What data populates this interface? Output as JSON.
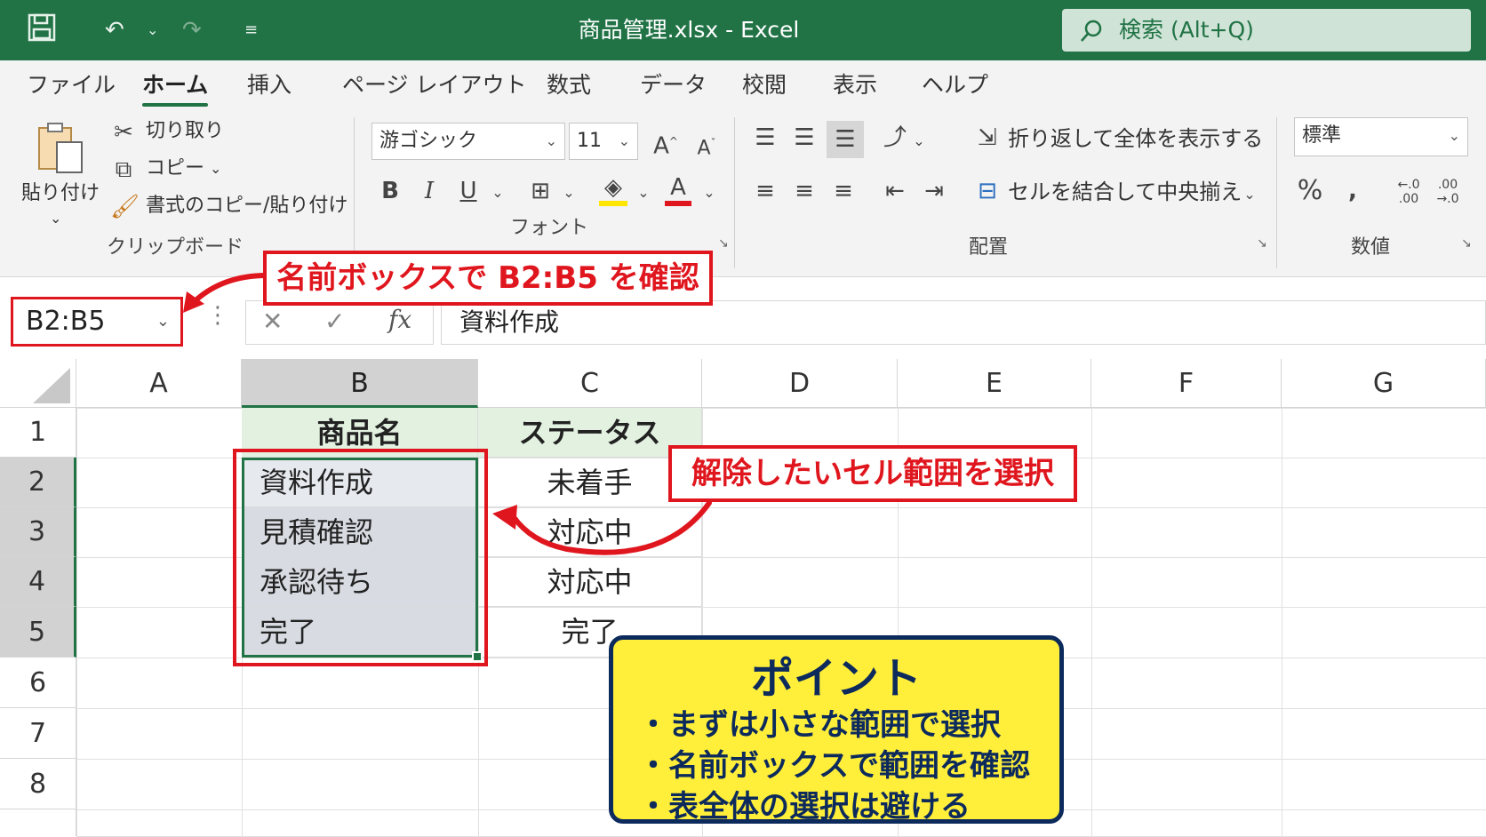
{
  "window": {
    "title": "商品管理.xlsx  -  Excel",
    "search_label": "検索 (Alt+Q)"
  },
  "tabs": [
    {
      "label": "ファイル",
      "active": false
    },
    {
      "label": "ホーム",
      "active": true
    },
    {
      "label": "挿入",
      "active": false
    },
    {
      "label": "ページ レイアウト",
      "active": false
    },
    {
      "label": "数式",
      "active": false
    },
    {
      "label": "データ",
      "active": false
    },
    {
      "label": "校閲",
      "active": false
    },
    {
      "label": "表示",
      "active": false
    },
    {
      "label": "ヘルプ",
      "active": false
    }
  ],
  "ribbon": {
    "clipboard": {
      "paste": "貼り付け",
      "cut": "切り取り",
      "copy": "コピー",
      "format_painter": "書式のコピー/貼り付け",
      "label": "クリップボード"
    },
    "font": {
      "font_name": "游ゴシック",
      "font_size": "11",
      "label": "フォント"
    },
    "alignment": {
      "wrap_text": "折り返して全体を表示する",
      "merge_center": "セルを結合して中央揃え",
      "label": "配置"
    },
    "number": {
      "format": "標準",
      "label": "数値"
    }
  },
  "formula_bar": {
    "name_box": "B2:B5",
    "formula": "資料作成"
  },
  "columns": [
    "A",
    "B",
    "C",
    "D",
    "E",
    "F",
    "G"
  ],
  "rows": [
    "1",
    "2",
    "3",
    "4",
    "5",
    "6",
    "7",
    "8"
  ],
  "cells": {
    "B1": "商品名",
    "C1": "ステータス",
    "B2": "資料作成",
    "C2": "未着手",
    "B3": "見積確認",
    "C3": "対応中",
    "B4": "承認待ち",
    "C4": "対応中",
    "B5": "完了",
    "C5": "完了"
  },
  "annotations": {
    "namebox_callout": "名前ボックスで B2:B5 を確認",
    "range_callout": "解除したいセル範囲を選択",
    "point_title": "ポイント",
    "point_items": [
      "・まずは小さな範囲で選択",
      "・名前ボックスで範囲を確認",
      "・表全体の選択は避ける"
    ]
  },
  "colors": {
    "excel_green": "#217346",
    "callout_red": "#e0161e",
    "point_yellow": "#ffef3a",
    "point_navy": "#0d2a5c"
  }
}
